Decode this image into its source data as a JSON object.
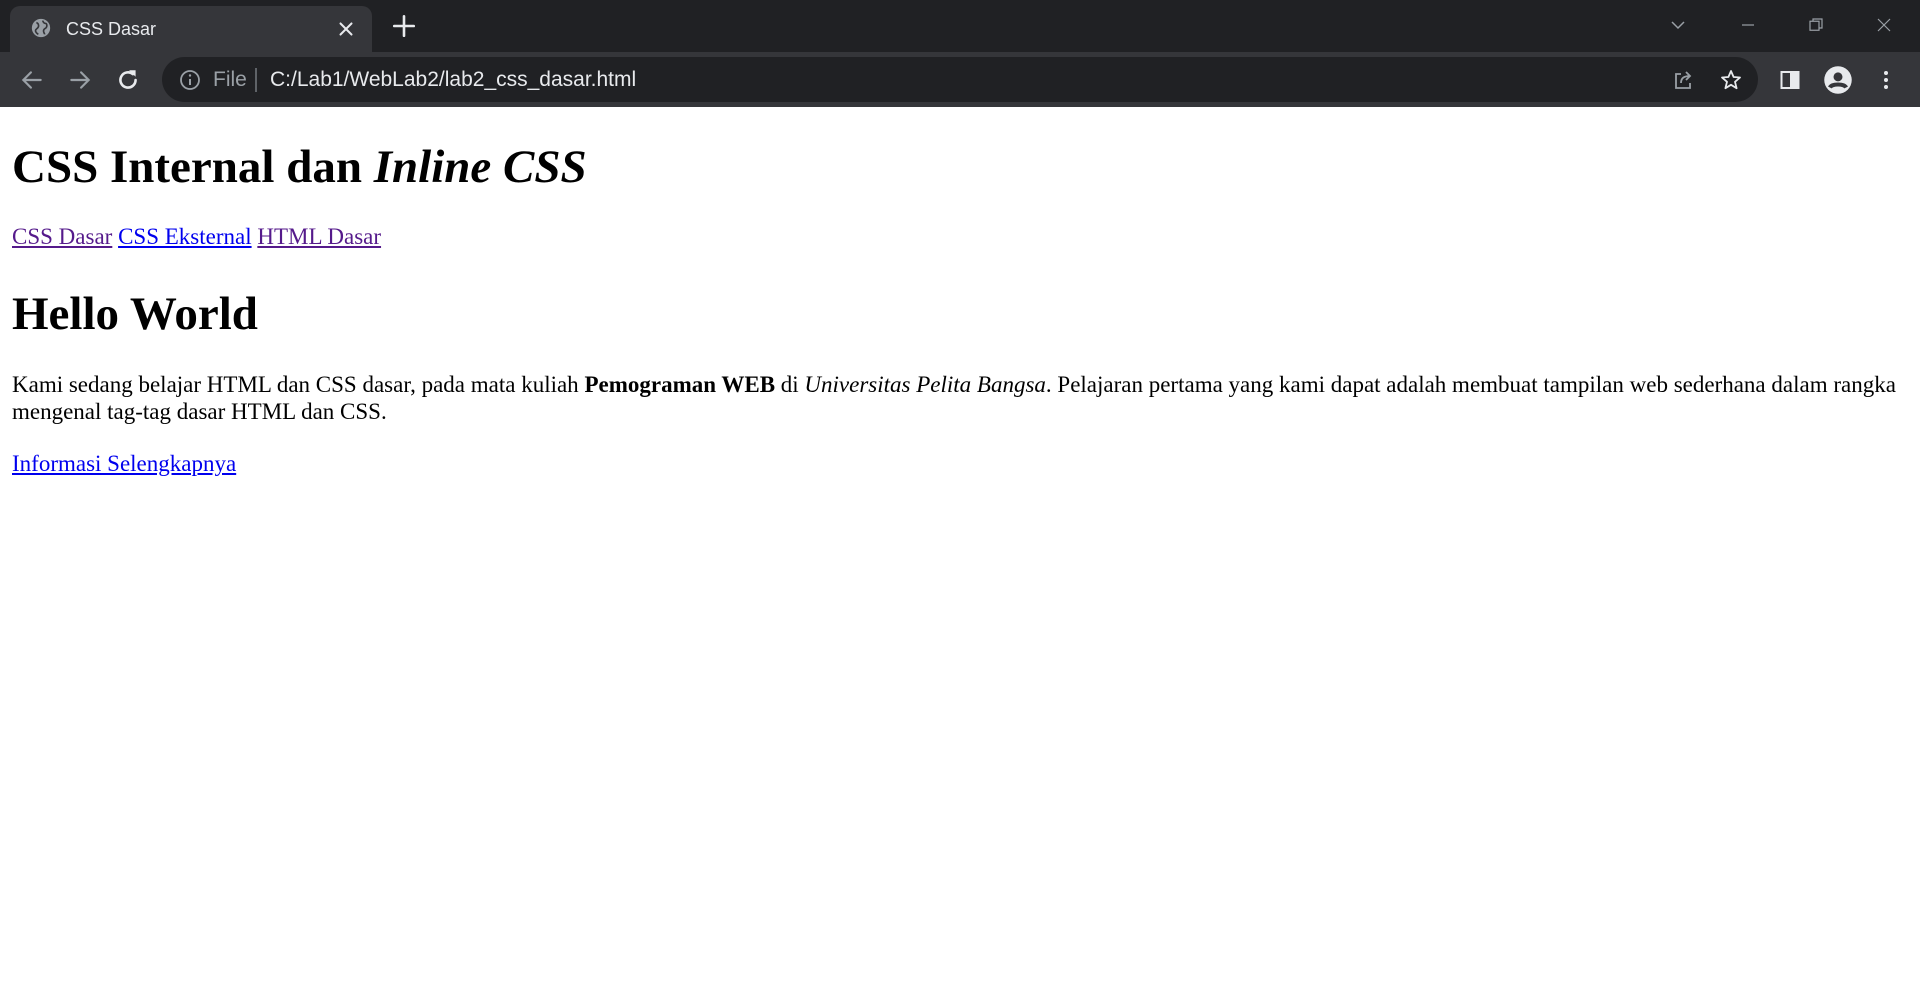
{
  "browser": {
    "tab": {
      "title": "CSS Dasar",
      "favicon": "globe-icon"
    },
    "address_bar": {
      "scheme_label": "File",
      "url": "C:/Lab1/WebLab2/lab2_css_dasar.html"
    },
    "colors": {
      "tabstrip": "#202124",
      "toolbar": "#35363a",
      "omnibox": "#202124",
      "text": "#e8eaed"
    }
  },
  "page": {
    "title_text": "CSS Internal dan ",
    "title_italic": "Inline CSS",
    "nav_links": [
      {
        "label": "CSS Dasar",
        "visited": true
      },
      {
        "label": "CSS Eksternal",
        "visited": false
      },
      {
        "label": "HTML Dasar",
        "visited": true
      }
    ],
    "heading": "Hello World",
    "paragraph": {
      "part1": "Kami sedang belajar HTML dan CSS dasar, pada mata kuliah ",
      "bold": "Pemograman WEB",
      "part2": " di ",
      "italic": "Universitas Pelita Bangsa",
      "part3": ". Pelajaran pertama yang kami dapat adalah membuat tampilan web sederhana dalam rangka mengenal tag-tag dasar HTML dan CSS."
    },
    "more_link": "Informasi Selengkapnya",
    "colors": {
      "link": "#0000ee",
      "visited_link": "#551a8b"
    }
  }
}
